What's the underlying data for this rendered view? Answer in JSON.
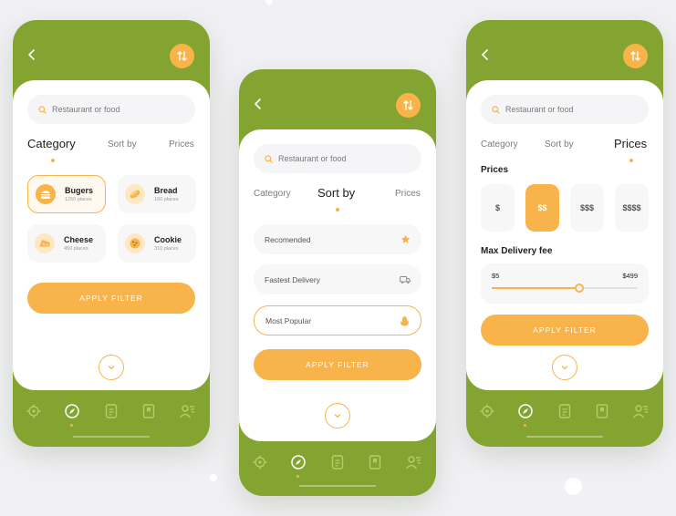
{
  "colors": {
    "brand_green": "#84a432",
    "accent_orange": "#f8b34a",
    "card_bg": "#ffffff",
    "page_bg": "#f1f1f5"
  },
  "search": {
    "placeholder": "Restaurant or food"
  },
  "tabs": {
    "category": "Category",
    "sort_by": "Sort by",
    "prices": "Prices"
  },
  "screen1": {
    "active_tab": "category",
    "categories": [
      {
        "name": "Bugers",
        "sub": "1250 places",
        "icon": "burger-icon",
        "selected": true
      },
      {
        "name": "Bread",
        "sub": "160 places",
        "icon": "bread-icon",
        "selected": false
      },
      {
        "name": "Cheese",
        "sub": "450 places",
        "icon": "cheese-icon",
        "selected": false
      },
      {
        "name": "Cookie",
        "sub": "310 places",
        "icon": "cookie-icon",
        "selected": false
      }
    ],
    "apply_label": "APPLY FILTER"
  },
  "screen2": {
    "active_tab": "sort_by",
    "options": [
      {
        "label": "Recomended",
        "icon": "star-icon",
        "selected": false
      },
      {
        "label": "Fastest Delivery",
        "icon": "truck-icon",
        "selected": false
      },
      {
        "label": "Most Popular",
        "icon": "flame-icon",
        "selected": true
      }
    ],
    "apply_label": "APPLY FILTER"
  },
  "screen3": {
    "active_tab": "prices",
    "prices_label": "Prices",
    "price_levels": [
      {
        "label": "$",
        "selected": false
      },
      {
        "label": "$$",
        "selected": true
      },
      {
        "label": "$$$",
        "selected": false
      },
      {
        "label": "$$$$",
        "selected": false
      }
    ],
    "delivery_label": "Max Delivery fee",
    "delivery_min": "$5",
    "delivery_max": "$499",
    "delivery_value_fraction": 0.6,
    "apply_label": "APPLY FILTER"
  },
  "bottom_nav": {
    "items": [
      "location-icon",
      "compass-icon",
      "document-icon",
      "bookmark-icon",
      "user-list-icon"
    ],
    "active_index": 1
  }
}
